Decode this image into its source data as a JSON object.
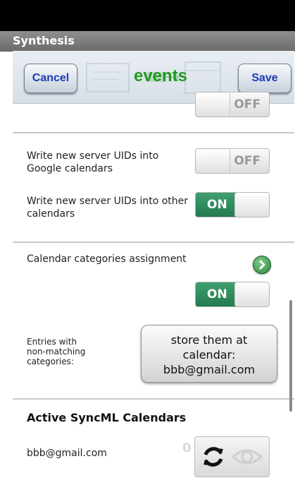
{
  "window": {
    "title": "Synthesis"
  },
  "toolbar": {
    "cancel_label": "Cancel",
    "title": "events",
    "save_label": "Save"
  },
  "settings": {
    "partial_toggle": {
      "state_label": "OFF"
    },
    "write_google": {
      "label_line1": "Write new server UIDs into",
      "label_line2": "Google calendars",
      "state_label": "OFF"
    },
    "write_other": {
      "label_line1": "Write new server UIDs into other",
      "label_line2": "calendars",
      "state_label": "ON"
    },
    "category_assignment": {
      "label": "Calendar categories assignment",
      "state_label": "ON"
    },
    "non_matching": {
      "label_line1": "Entries with",
      "label_line2": "non-matching",
      "label_line3": "categories:",
      "button_line1": "store them at",
      "button_line2": "calendar:",
      "button_line3": "bbb@gmail.com"
    }
  },
  "active_calendars": {
    "heading": "Active SyncML Calendars",
    "items": [
      {
        "account": "bbb@gmail.com",
        "count": "0"
      }
    ]
  },
  "icons": {
    "arrow": "chevron-right-icon",
    "sync": "sync-icon",
    "visibility": "eye-icon"
  },
  "colors": {
    "accent_green": "#229922",
    "toggle_on": "#2f8f5f",
    "button_text": "#1a3cb5"
  }
}
